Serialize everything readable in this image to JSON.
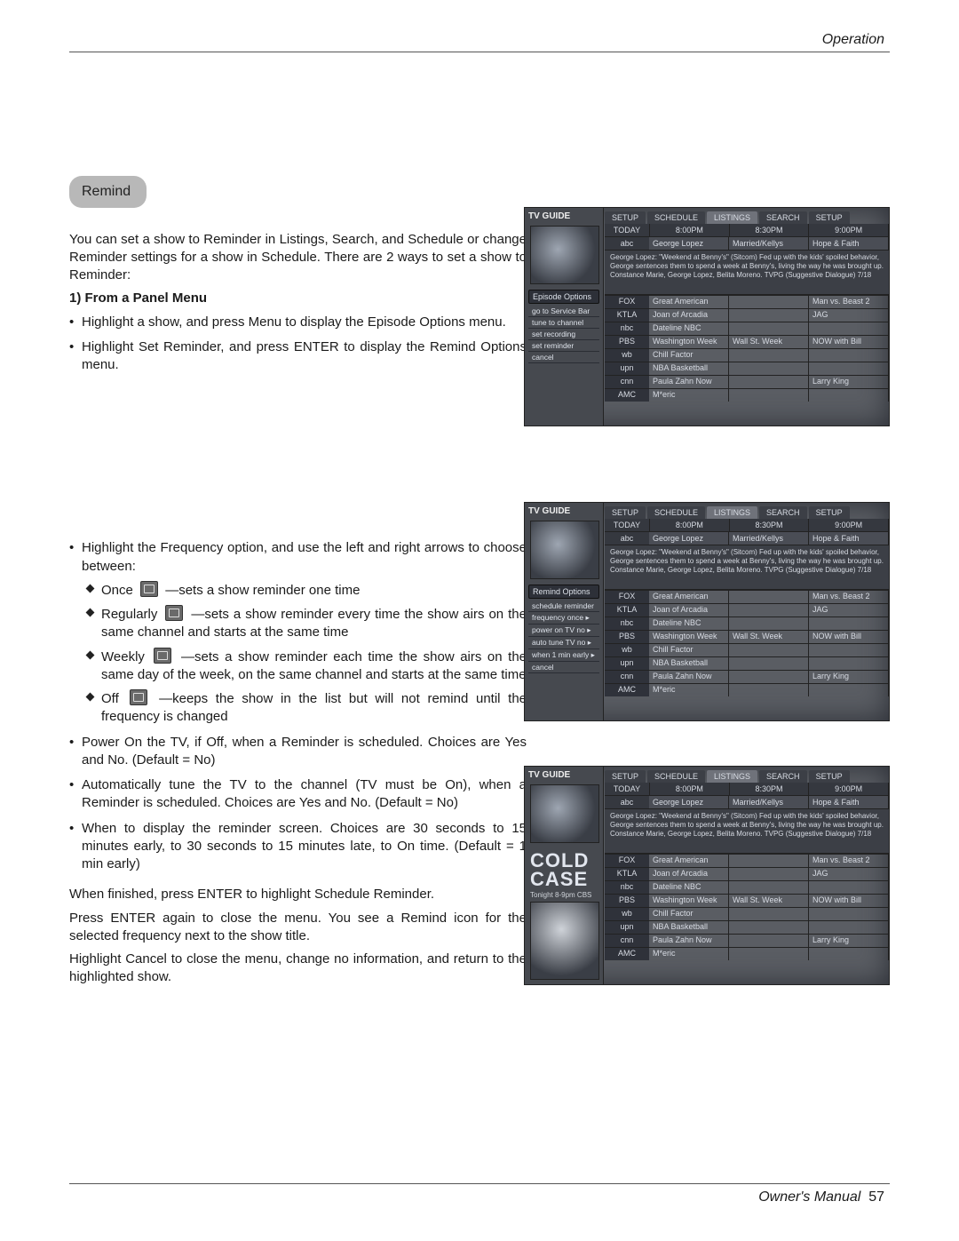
{
  "header": {
    "section_label": "Operation"
  },
  "footer": {
    "manual_label": "Owner's Manual",
    "page_number": "57"
  },
  "section": {
    "pill": "Remind"
  },
  "intro": "You can set a show to Reminder in Listings, Search, and Schedule or change Reminder settings for a show in Schedule. There are 2 ways to set a show to Reminder:",
  "subhead1": "1) From a Panel Menu",
  "bullets_a": [
    "Highlight a show, and press Menu to display the Episode Options  menu.",
    "Highlight Set Reminder, and press ENTER to display the Remind Options menu."
  ],
  "bullet_freq_lead": "Highlight the Frequency option, and use the left and right arrows to choose between:",
  "freq_sub": [
    {
      "label": "Once",
      "tail": "—sets a show reminder one time"
    },
    {
      "label": "Regularly",
      "tail": "—sets a show reminder every time the show airs on the same channel and starts at the same time"
    },
    {
      "label": "Weekly",
      "tail": "—sets a show reminder each time the show airs on the same day of the week, on the same channel and starts at the same time"
    },
    {
      "label": "Off",
      "tail": "—keeps the show in the list but will not remind until the frequency is changed"
    }
  ],
  "bullets_b": [
    "Power On the TV, if Off, when a Reminder is scheduled. Choices are Yes and No. (Default = No)",
    "Automatically tune the TV to the channel (TV must be On), when a Reminder is scheduled. Choices are Yes and No. (Default = No)",
    "When to display the reminder screen. Choices are 30 seconds to 15 minutes early, to 30 seconds to 15 minutes late, to On time. (Default = 1 min early)"
  ],
  "closing": [
    "When finished, press ENTER to highlight Schedule Reminder.",
    "Press ENTER again to close the menu. You see a Remind icon for the selected frequency next to the show title.",
    "Highlight Cancel to close the menu, change no information, and return to the highlighted show."
  ],
  "guide": {
    "logo": "TV GUIDE",
    "tabs": [
      "SETUP",
      "SCHEDULE",
      "LISTINGS",
      "SEARCH",
      "SETUP"
    ],
    "active_tab_index": 2,
    "time_header": {
      "first": "TODAY",
      "cols": [
        "8:00PM",
        "8:30PM",
        "9:00PM"
      ]
    },
    "program_row": {
      "ch": "abc",
      "cols": [
        "George Lopez",
        "Married/Kellys",
        "Hope & Faith"
      ]
    },
    "desc": "George Lopez: \"Weekend at Benny's\" (Sitcom) Fed up with the kids' spoiled behavior, George sentences them to spend a week at Benny's, living the way he was brought up. Constance Marie, George Lopez, Belita Moreno. TVPG (Suggestive Dialogue) 7/18",
    "grid": [
      {
        "ch": "FOX",
        "cells": [
          "Great American",
          "",
          "Man vs. Beast 2"
        ]
      },
      {
        "ch": "KTLA",
        "cells": [
          "Joan of Arcadia",
          "",
          "JAG"
        ]
      },
      {
        "ch": "nbc",
        "cells": [
          "Dateline NBC",
          "",
          ""
        ]
      },
      {
        "ch": "PBS",
        "cells": [
          "Washington Week",
          "Wall St. Week",
          "NOW with Bill"
        ],
        "hl": true
      },
      {
        "ch": "wb",
        "cells": [
          "Chill Factor",
          "",
          ""
        ]
      },
      {
        "ch": "upn",
        "cells": [
          "NBA Basketball",
          "",
          ""
        ]
      },
      {
        "ch": "cnn",
        "cells": [
          "Paula Zahn Now",
          "",
          "Larry King"
        ]
      },
      {
        "ch": "AMC",
        "cells": [
          "M*eric",
          "",
          ""
        ]
      }
    ]
  },
  "panel1": {
    "title": "Episode Options",
    "items": [
      "go to Service Bar",
      "tune to channel",
      "set recording",
      "set reminder",
      "cancel"
    ]
  },
  "panel2": {
    "title": "Remind Options",
    "items": [
      "schedule reminder",
      "frequency   once  ▸",
      "power on TV   no  ▸",
      "auto tune TV   no  ▸",
      "when   1 min early  ▸",
      "cancel"
    ]
  },
  "panel3": {
    "cold": "COLD CASE",
    "sub": "Tonight 8-9pm  CBS"
  }
}
